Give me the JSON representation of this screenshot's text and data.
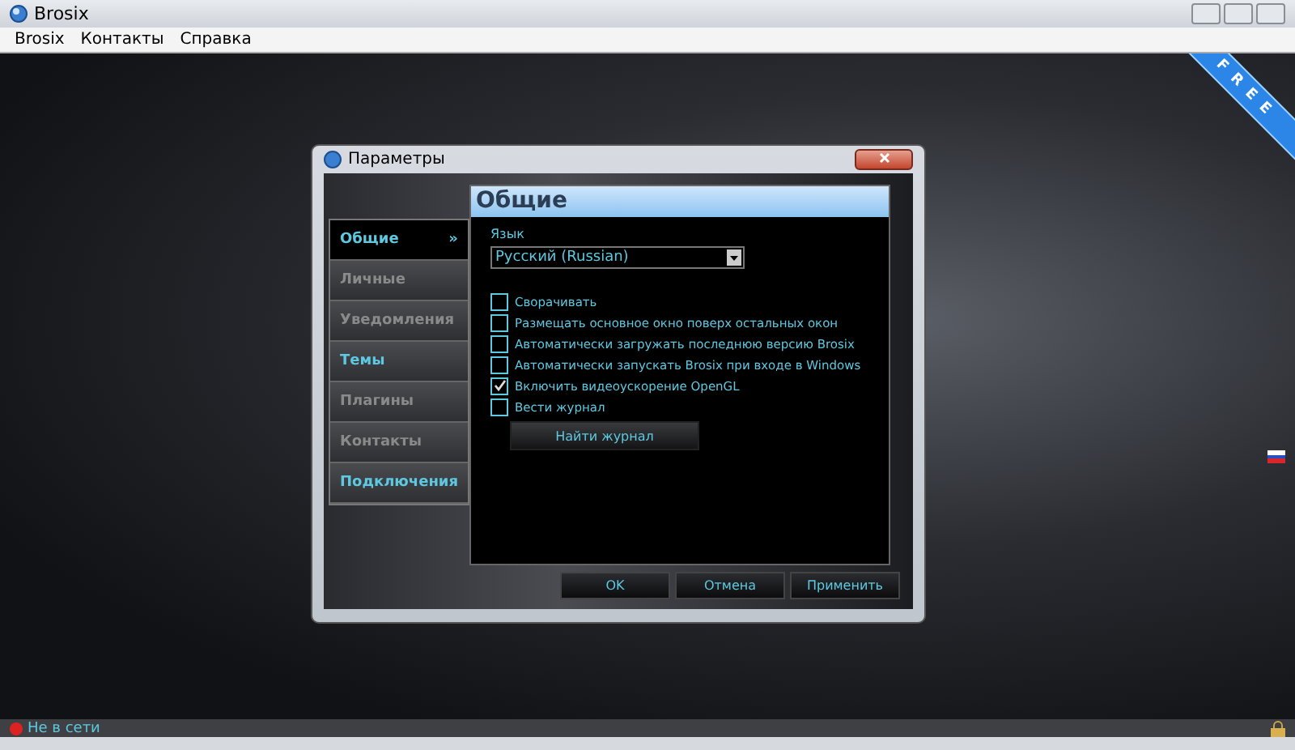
{
  "window": {
    "title": "Brosix"
  },
  "menu": [
    "Brosix",
    "Контакты",
    "Справка"
  ],
  "ribbon": "FREE",
  "dialog": {
    "title": "Параметры",
    "sidebar": [
      {
        "label": "Общие",
        "selected": true,
        "color": "#5ec8e0",
        "arrow": "»"
      },
      {
        "label": "Личные",
        "selected": false,
        "color": "#8a8a8a"
      },
      {
        "label": "Уведомления",
        "selected": false,
        "color": "#8a8a8a"
      },
      {
        "label": "Темы",
        "selected": false,
        "color": "#5ec8e0"
      },
      {
        "label": "Плагины",
        "selected": false,
        "color": "#8a8a8a"
      },
      {
        "label": "Контакты",
        "selected": false,
        "color": "#8a8a8a"
      },
      {
        "label": "Подключения",
        "selected": false,
        "color": "#5ec8e0"
      }
    ],
    "panel_title": "Общие",
    "language_label": "Язык",
    "language_value": "Русский (Russian)",
    "options": [
      {
        "label": "Сворачивать",
        "checked": false
      },
      {
        "label": "Размещать основное окно поверх остальных окон",
        "checked": false
      },
      {
        "label": "Автоматически загружать последнюю версию Brosix",
        "checked": false
      },
      {
        "label": "Автоматически запускать Brosix при входе в Windows",
        "checked": false
      },
      {
        "label": "Включить видеоускорение OpenGL",
        "checked": true
      },
      {
        "label": "Вести журнал",
        "checked": false
      }
    ],
    "find_log_button": "Найти журнал",
    "buttons": [
      "OK",
      "Отмена",
      "Применить"
    ]
  },
  "status_bar": {
    "status": "Не в сети"
  }
}
